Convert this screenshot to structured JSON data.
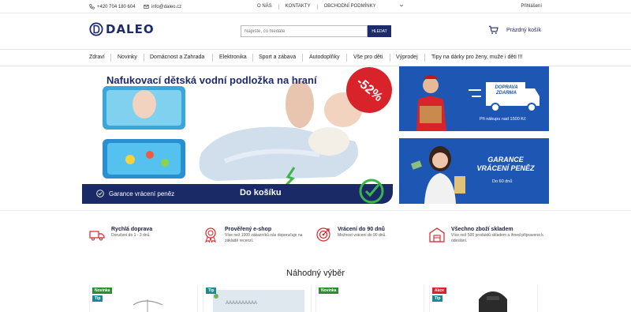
{
  "topbar": {
    "phone": "+420 704 180 604",
    "email": "info@daleo.cz",
    "links": [
      "O NÁS",
      "KONTAKTY",
      "OBCHODNÍ PODMÍNKY"
    ],
    "login": "Přihlášení"
  },
  "header": {
    "logo": "DALEO",
    "search_placeholder": "Napište, co hledáte",
    "search_button": "HLEDAT",
    "cart_label": "Prázdný košík"
  },
  "nav": [
    "Zdraví",
    "Novinky",
    "Domácnost a Zahrada",
    "Elektronika",
    "Sport a zábava",
    "Autodoplňky",
    "Vše pro děti",
    "Výprodej",
    "Tipy na dárky pro ženy, muže i děti !!!"
  ],
  "hero": {
    "title": "Nafukovací dětská vodní podložka na hraní",
    "discount": "-52%",
    "guarantee": "Garance vrácení peněz",
    "cta": "Do košíku"
  },
  "banners": [
    {
      "title_lines": [
        "DOPRAVA",
        "ZDARMA"
      ],
      "subtitle": "Při nákupu nad 1500 Kč"
    },
    {
      "title_lines": [
        "GARANCE",
        "VRÁCENÍ PENĚZ"
      ],
      "subtitle": "Do 60 dnů"
    }
  ],
  "features": [
    {
      "title": "Rychlá doprava",
      "desc": "Doručení do 1 - 3 dnů."
    },
    {
      "title": "Prověřený e-shop",
      "desc": "Více než 1000 zákazníků nás doporučuje na základě recenzí."
    },
    {
      "title": "Vrácení do 90 dnů",
      "desc": "Možnost vrácení do 90 dnů."
    },
    {
      "title": "Všechno zboží skladem",
      "desc": "Více než 500 produktů skladem a ihned připraveno k odeslání."
    }
  ],
  "random_title": "Náhodný výběr",
  "products": [
    {
      "tags": [
        {
          "label": "Novinka",
          "color": "#2e8b2e"
        },
        {
          "label": "Tip",
          "color": "#1b8a95"
        }
      ]
    },
    {
      "tags": [
        {
          "label": "Tip",
          "color": "#1b8a95"
        }
      ]
    },
    {
      "tags": [
        {
          "label": "Novinka",
          "color": "#2e8b2e"
        }
      ]
    },
    {
      "tags": [
        {
          "label": "Akce",
          "color": "#d8232a"
        },
        {
          "label": "Tip",
          "color": "#1b8a95"
        }
      ]
    }
  ],
  "colors": {
    "brand": "#1d2a6b",
    "accent": "#d8232a",
    "banner": "#1e56b3"
  }
}
